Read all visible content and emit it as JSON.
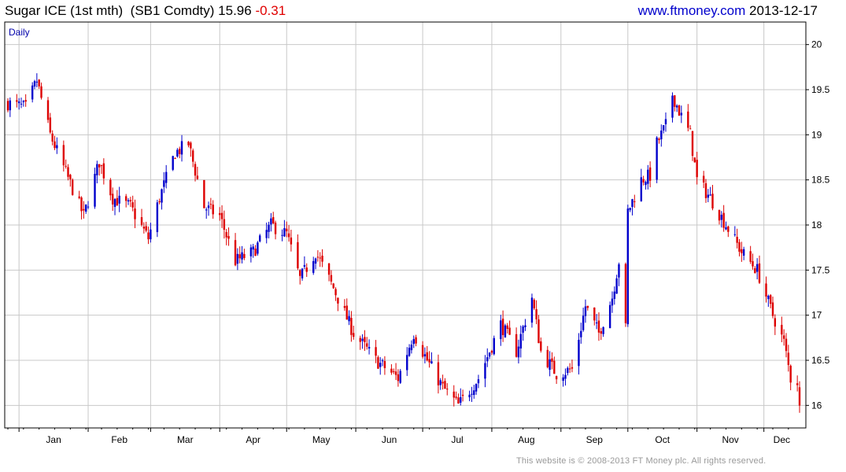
{
  "header": {
    "instrument": "Sugar ICE (1st mth)",
    "ticker": "(SB1 Comdty)",
    "last": "15.96",
    "change": "-0.31",
    "site": "www.ftmoney.com",
    "date": "2013-12-17"
  },
  "footer": {
    "copyright": "This website is © 2008-2013 FT Money plc. All rights reserved."
  },
  "colors": {
    "up": "#0000cc",
    "down": "#dd0000",
    "grid": "#c8c8c8",
    "axis": "#000000"
  },
  "chart_data": {
    "type": "candlestick",
    "period_label": "Daily",
    "x_range": [
      "2012-12-27",
      "2013-12-17"
    ],
    "month_labels": [
      "Jan",
      "Feb",
      "Mar",
      "Apr",
      "May",
      "Jun",
      "Jul",
      "Aug",
      "Sep",
      "Oct",
      "Nov",
      "Dec"
    ],
    "y_ticks": [
      16,
      16.5,
      17,
      17.5,
      18,
      18.5,
      19,
      19.5,
      20
    ],
    "y_axis_side": "right",
    "ylim": [
      15.75,
      20.25
    ],
    "grid": true,
    "key_points": [
      {
        "date": "2012-12-27",
        "price": 19.35
      },
      {
        "date": "2013-01-04",
        "price": 19.3
      },
      {
        "date": "2013-01-09",
        "price": 19.6
      },
      {
        "date": "2013-01-15",
        "price": 19.0
      },
      {
        "date": "2013-01-25",
        "price": 18.4
      },
      {
        "date": "2013-01-30",
        "price": 18.1
      },
      {
        "date": "2013-02-06",
        "price": 18.7
      },
      {
        "date": "2013-02-12",
        "price": 18.3
      },
      {
        "date": "2013-02-20",
        "price": 18.2
      },
      {
        "date": "2013-02-28",
        "price": 17.85
      },
      {
        "date": "2013-03-05",
        "price": 18.3
      },
      {
        "date": "2013-03-12",
        "price": 18.8
      },
      {
        "date": "2013-03-18",
        "price": 18.9
      },
      {
        "date": "2013-03-25",
        "price": 18.2
      },
      {
        "date": "2013-04-01",
        "price": 18.1
      },
      {
        "date": "2013-04-08",
        "price": 17.6
      },
      {
        "date": "2013-04-16",
        "price": 17.7
      },
      {
        "date": "2013-04-24",
        "price": 18.0
      },
      {
        "date": "2013-05-01",
        "price": 17.9
      },
      {
        "date": "2013-05-07",
        "price": 17.4
      },
      {
        "date": "2013-05-14",
        "price": 17.7
      },
      {
        "date": "2013-05-22",
        "price": 17.3
      },
      {
        "date": "2013-05-31",
        "price": 16.8
      },
      {
        "date": "2013-06-10",
        "price": 16.5
      },
      {
        "date": "2013-06-20",
        "price": 16.3
      },
      {
        "date": "2013-06-27",
        "price": 16.8
      },
      {
        "date": "2013-07-03",
        "price": 16.5
      },
      {
        "date": "2013-07-10",
        "price": 16.2
      },
      {
        "date": "2013-07-17",
        "price": 16.0
      },
      {
        "date": "2013-07-26",
        "price": 16.3
      },
      {
        "date": "2013-08-05",
        "price": 16.9
      },
      {
        "date": "2013-08-12",
        "price": 16.6
      },
      {
        "date": "2013-08-19",
        "price": 17.2
      },
      {
        "date": "2013-08-23",
        "price": 16.6
      },
      {
        "date": "2013-08-30",
        "price": 16.35
      },
      {
        "date": "2013-09-06",
        "price": 16.4
      },
      {
        "date": "2013-09-12",
        "price": 17.1
      },
      {
        "date": "2013-09-18",
        "price": 16.8
      },
      {
        "date": "2013-09-24",
        "price": 17.2
      },
      {
        "date": "2013-09-27",
        "price": 17.6
      },
      {
        "date": "2013-09-30",
        "price": 16.85
      },
      {
        "date": "2013-10-01",
        "price": 18.15
      },
      {
        "date": "2013-10-07",
        "price": 18.5
      },
      {
        "date": "2013-10-11",
        "price": 18.55
      },
      {
        "date": "2013-10-14",
        "price": 18.9
      },
      {
        "date": "2013-10-18",
        "price": 19.1
      },
      {
        "date": "2013-10-21",
        "price": 19.45
      },
      {
        "date": "2013-10-25",
        "price": 19.2
      },
      {
        "date": "2013-10-29",
        "price": 19.0
      },
      {
        "date": "2013-11-01",
        "price": 18.5
      },
      {
        "date": "2013-11-07",
        "price": 18.3
      },
      {
        "date": "2013-11-14",
        "price": 18.0
      },
      {
        "date": "2013-11-21",
        "price": 17.7
      },
      {
        "date": "2013-11-28",
        "price": 17.5
      },
      {
        "date": "2013-12-05",
        "price": 17.0
      },
      {
        "date": "2013-12-10",
        "price": 16.7
      },
      {
        "date": "2013-12-13",
        "price": 16.3
      },
      {
        "date": "2013-12-16",
        "price": 16.27
      },
      {
        "date": "2013-12-17",
        "price": 15.96
      }
    ]
  }
}
